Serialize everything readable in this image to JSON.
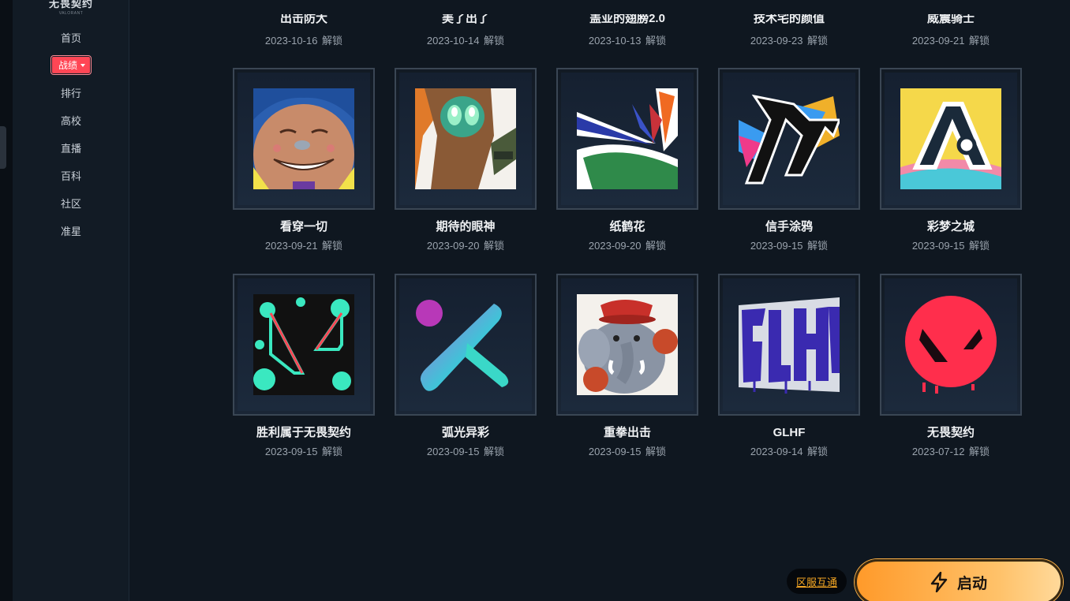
{
  "sidebar": {
    "logo": "无畏契约",
    "logo_sub": "VALORANT",
    "items": [
      {
        "label": "首页"
      },
      {
        "label": "战绩"
      },
      {
        "label": "排行"
      },
      {
        "label": "高校"
      },
      {
        "label": "直播"
      },
      {
        "label": "百科"
      },
      {
        "label": "社区"
      },
      {
        "label": "准星"
      }
    ]
  },
  "top_row": [
    {
      "title": "出击防大",
      "date": "2023-10-16",
      "status": "解锁"
    },
    {
      "title": "美了出了",
      "date": "2023-10-14",
      "status": "解锁"
    },
    {
      "title": "盖亚的翅膀2.0",
      "date": "2023-10-13",
      "status": "解锁"
    },
    {
      "title": "技术宅的颜值",
      "date": "2023-09-23",
      "status": "解锁"
    },
    {
      "title": "威震骑士",
      "date": "2023-09-21",
      "status": "解锁"
    }
  ],
  "cards": [
    {
      "title": "看穿一切",
      "date": "2023-09-21",
      "status": "解锁",
      "icon": "grinning-face-icon"
    },
    {
      "title": "期待的眼神",
      "date": "2023-09-20",
      "status": "解锁",
      "icon": "alien-eyes-icon"
    },
    {
      "title": "纸鹤花",
      "date": "2023-09-20",
      "status": "解锁",
      "icon": "bird-of-paradise-icon"
    },
    {
      "title": "信手涂鸦",
      "date": "2023-09-15",
      "status": "解锁",
      "icon": "graffiti-scribble-icon"
    },
    {
      "title": "彩梦之城",
      "date": "2023-09-15",
      "status": "解锁",
      "icon": "color-dream-city-icon"
    },
    {
      "title": "胜利属于无畏契约",
      "date": "2023-09-15",
      "status": "解锁",
      "icon": "valorant-v-splatter-icon"
    },
    {
      "title": "弧光异彩",
      "date": "2023-09-15",
      "status": "解锁",
      "icon": "gradient-k-icon"
    },
    {
      "title": "重拳出击",
      "date": "2023-09-15",
      "status": "解锁",
      "icon": "boxing-elephant-icon"
    },
    {
      "title": "GLHF",
      "date": "2023-09-14",
      "status": "解锁",
      "icon": "glhf-graffiti-icon"
    },
    {
      "title": "无畏契约",
      "date": "2023-07-12",
      "status": "解锁",
      "icon": "valorant-logo-icon"
    }
  ],
  "footer": {
    "region_label": "区服互通",
    "launch_label": "启动"
  },
  "colors": {
    "accent": "#ff4655",
    "launch_from": "#ff9a2a",
    "launch_to": "#ffd99a",
    "background": "#0f1720"
  }
}
